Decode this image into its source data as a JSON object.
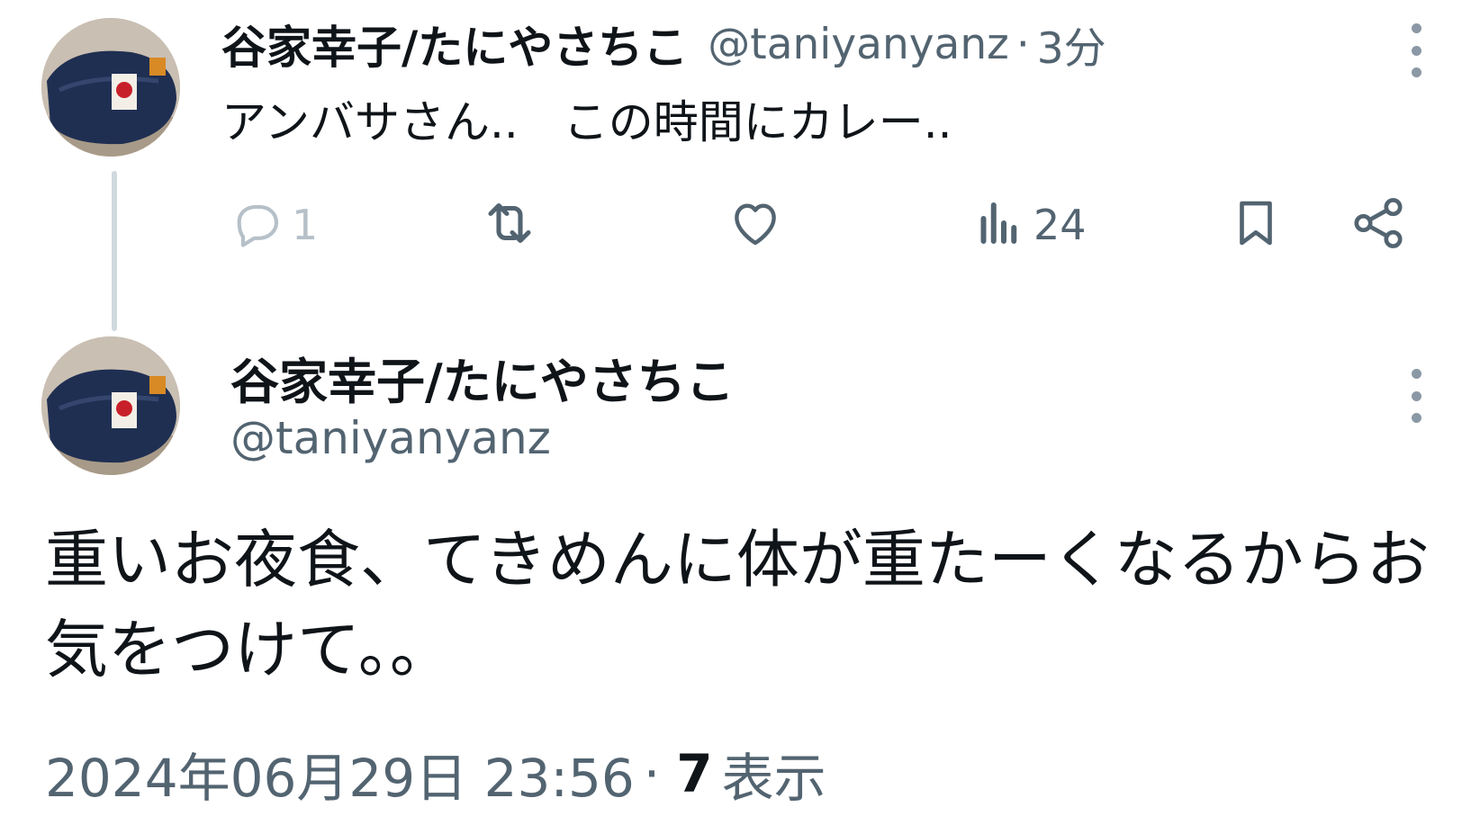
{
  "reply_tweet": {
    "display_name": "谷家幸子/たにやさちこ",
    "handle": "@taniyanyanz",
    "separator": "·",
    "time": "3分",
    "text": "アンバサさん..　この時間にカレー..",
    "actions": {
      "reply_count": "1",
      "views_count": "24"
    },
    "icons": [
      "reply-icon",
      "retweet-icon",
      "like-icon",
      "views-icon",
      "bookmark-icon",
      "share-icon",
      "more-icon"
    ]
  },
  "main_tweet": {
    "display_name": "谷家幸子/たにやさちこ",
    "handle": "@taniyanyanz",
    "text": "重いお夜食、てきめんに体が重たーくなるからお気をつけて。。",
    "timestamp": "2024年06月29日 23:56",
    "separator": "·",
    "views": "7",
    "views_label": "表示"
  },
  "colors": {
    "text_primary": "#0f1419",
    "text_secondary": "#536471",
    "thread_line": "#cfd9de"
  }
}
